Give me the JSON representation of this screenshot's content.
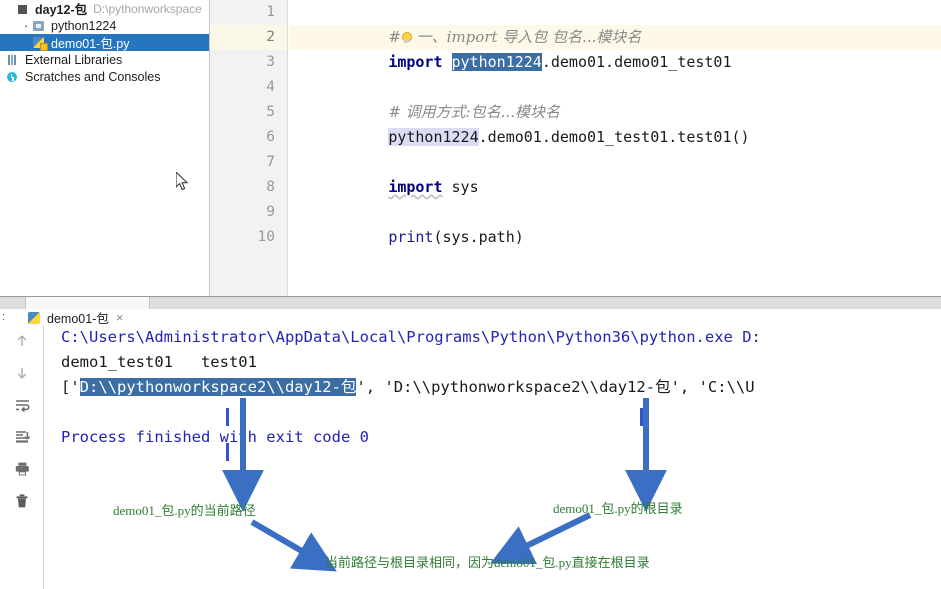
{
  "project": {
    "root": {
      "label": "day12-包",
      "path": "D:\\pythonworkspace",
      "icon": "project-square-icon"
    },
    "items": [
      {
        "label": "python1224",
        "icon": "package-folder-icon",
        "selected": false,
        "indent": 2
      },
      {
        "label": "demo01-包.py",
        "icon": "python-file-icon",
        "selected": true,
        "indent": 2
      },
      {
        "label": "External Libraries",
        "icon": "external-libraries-icon",
        "selected": false,
        "indent": 0
      },
      {
        "label": "Scratches and Consoles",
        "icon": "scratches-icon",
        "selected": false,
        "indent": 0
      }
    ]
  },
  "editor": {
    "gutter": [
      "1",
      "2",
      "3",
      "4",
      "5",
      "6",
      "7",
      "8",
      "9",
      "10"
    ],
    "current_line": 2,
    "lines": [
      {
        "n": 1,
        "type": "comment",
        "bulb": true,
        "text": "# 一、import 导入包 包名...模块名"
      },
      {
        "n": 2,
        "type": "code",
        "kw": "import",
        "sel": "python1224",
        "rest": ".demo01.demo01_test01"
      },
      {
        "n": 3,
        "type": "blank",
        "text": ""
      },
      {
        "n": 4,
        "type": "comment",
        "text": "# 调用方式:包名...模块名"
      },
      {
        "n": 5,
        "type": "code",
        "lav": "python1224",
        "rest": ".demo01.demo01_test01.test01()"
      },
      {
        "n": 6,
        "type": "blank",
        "text": ""
      },
      {
        "n": 7,
        "type": "code",
        "kw": "import",
        "rest": " sys",
        "squiggle": true
      },
      {
        "n": 8,
        "type": "blank",
        "text": ""
      },
      {
        "n": 9,
        "type": "code",
        "fn": "print",
        "rest": "(sys.path)"
      },
      {
        "n": 10,
        "type": "blank",
        "text": ""
      }
    ]
  },
  "run_panel": {
    "tab": {
      "label": "demo01-包",
      "close": "×",
      "icon": "python-file-icon"
    },
    "toolbar": [
      {
        "name": "scroll-up-icon",
        "glyph": "↑"
      },
      {
        "name": "scroll-down-icon",
        "glyph": "↓"
      },
      {
        "name": "soft-wrap-icon",
        "glyph": "wrap"
      },
      {
        "name": "scroll-to-end-icon",
        "glyph": "end"
      },
      {
        "name": "print-icon",
        "glyph": "print"
      },
      {
        "name": "clear-all-icon",
        "glyph": "trash"
      }
    ],
    "output": [
      {
        "type": "cmd",
        "text": "C:\\Users\\Administrator\\AppData\\Local\\Programs\\Python\\Python36\\python.exe D:"
      },
      {
        "type": "plain",
        "text": "demo1_test01   test01"
      },
      {
        "type": "path",
        "prefix": "['",
        "highlighted": "D:\\\\pythonworkspace2\\\\day12-包",
        "suffix": "', 'D:\\\\pythonworkspace2\\\\day12-包', 'C:\\\\U"
      },
      {
        "type": "blank",
        "text": ""
      },
      {
        "type": "cmd",
        "text": "Process finished with exit code 0"
      }
    ]
  },
  "annotations": {
    "color": "#2e7d32",
    "arrow_color": "#3a6fc4",
    "notes": [
      {
        "id": "current-path-note",
        "text": "demo01_包.py的当前路径"
      },
      {
        "id": "root-dir-note",
        "text": "demo01_包.py的根目录"
      },
      {
        "id": "same-path-note",
        "text": "当前路径与根目录相同，因为demo01_包.py直接在根目录"
      }
    ]
  }
}
